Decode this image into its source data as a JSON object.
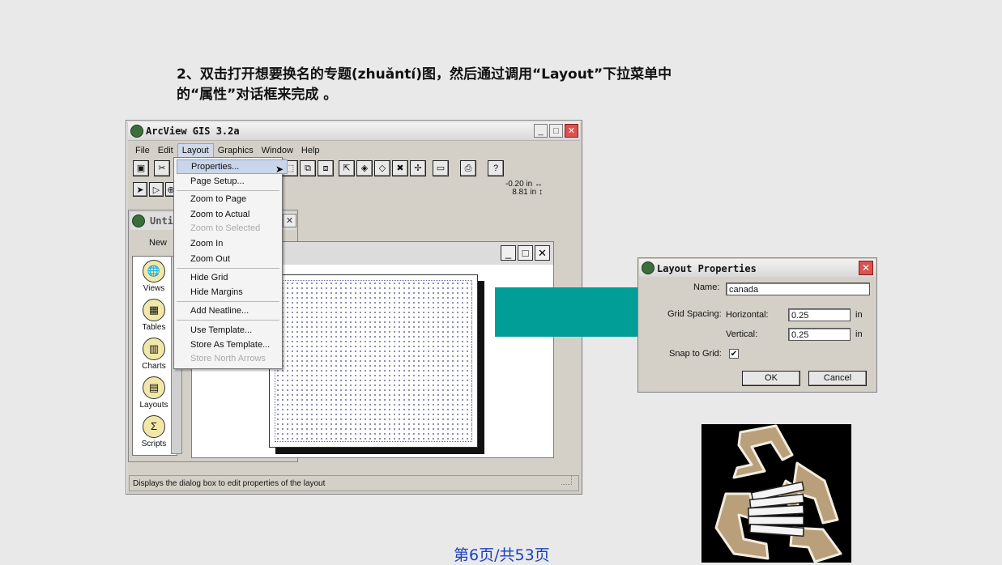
{
  "caption": {
    "line1": "2、双击打开想要换名的专题(zhuǎntí)图，然后通过调用“Layout”下拉菜单中",
    "line2": "的“属性”对话框来完成 。"
  },
  "arcview": {
    "title": "ArcView GIS 3.2a",
    "title_buttons": [
      "_",
      "□",
      "✕"
    ],
    "menus": [
      "File",
      "Edit",
      "Layout",
      "Graphics",
      "Window",
      "Help"
    ],
    "coords": [
      "-0.20 in",
      "8.81 in"
    ],
    "status_text": "Displays the dialog box to edit properties of the layout",
    "project": {
      "title": "Unti",
      "new_label": "New",
      "items": [
        "Views",
        "Tables",
        "Charts",
        "Layouts",
        "Scripts"
      ]
    },
    "doc_buttons": [
      "_",
      "□",
      "✕"
    ]
  },
  "layout_menu": {
    "items": [
      {
        "label": "Properties...",
        "highlighted": true
      },
      {
        "label": "Page Setup..."
      },
      {
        "label": "Zoom to Page"
      },
      {
        "label": "Zoom to Actual"
      },
      {
        "label": "Zoom to Selected",
        "disabled": true
      },
      {
        "label": "Zoom In"
      },
      {
        "label": "Zoom Out"
      },
      {
        "label": "Hide Grid"
      },
      {
        "label": "Hide Margins"
      },
      {
        "label": "Add Neatline..."
      },
      {
        "label": "Use Template..."
      },
      {
        "label": "Store As Template..."
      },
      {
        "label": "Store North Arrows",
        "disabled": true
      }
    ]
  },
  "dialog": {
    "title": "Layout Properties",
    "name_label": "Name:",
    "name_value": "canada",
    "grid_spacing_label": "Grid Spacing:",
    "horizontal_label": "Horizontal:",
    "horizontal_value": "0.25",
    "vertical_label": "Vertical:",
    "vertical_value": "0.25",
    "unit": "in",
    "snap_label": "Snap to Grid:",
    "snap_checked": "✔",
    "ok_label": "OK",
    "cancel_label": "Cancel"
  },
  "pager": "第6页/共53页",
  "colors": {
    "teal": "#009e96",
    "accent_blue": "#1a40c0"
  }
}
